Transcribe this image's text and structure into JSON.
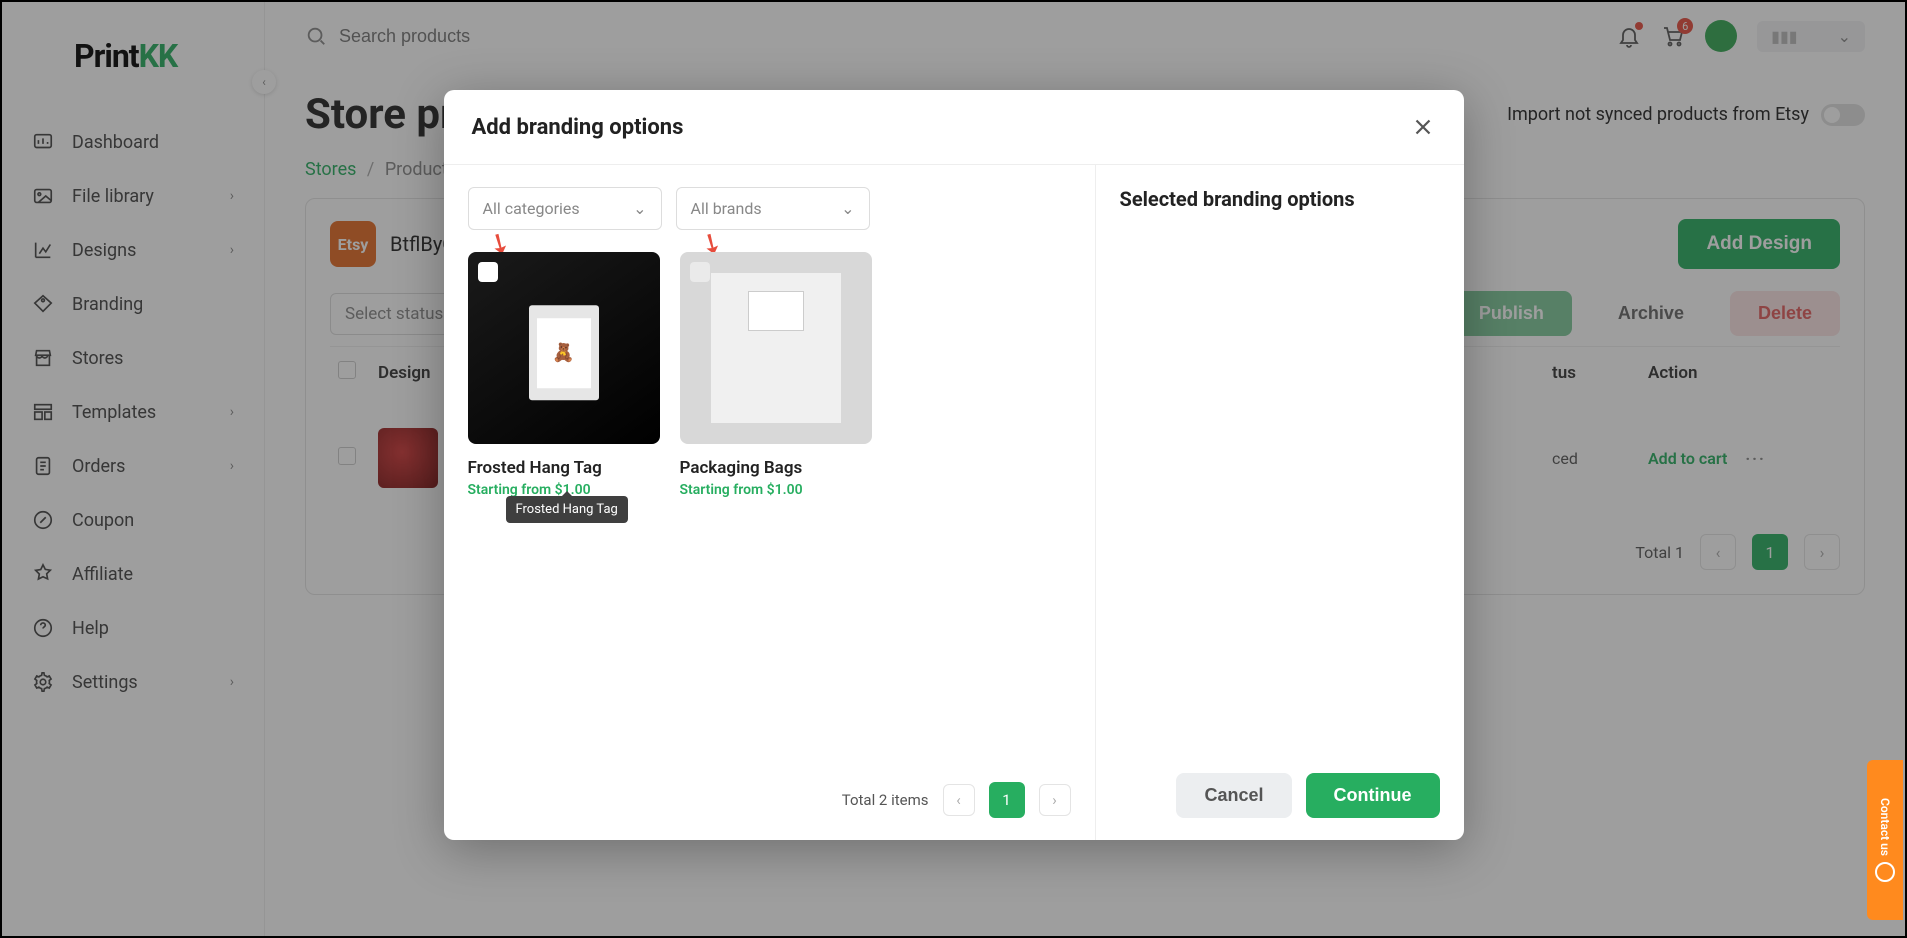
{
  "brand": {
    "p1": "Print",
    "p2": "KK"
  },
  "nav": {
    "dashboard": "Dashboard",
    "file_library": "File library",
    "designs": "Designs",
    "branding": "Branding",
    "stores": "Stores",
    "templates": "Templates",
    "orders": "Orders",
    "coupon": "Coupon",
    "affiliate": "Affiliate",
    "help": "Help",
    "settings": "Settings"
  },
  "search": {
    "placeholder": "Search products"
  },
  "header": {
    "cart_count": "6"
  },
  "page": {
    "title": "Store products",
    "import_label": "Import not synced products from Etsy"
  },
  "breadcrumb": {
    "stores": "Stores",
    "products": "Products"
  },
  "panel": {
    "shop_badge": "Etsy",
    "shop_name": "BtflByCe",
    "add_design": "Add Design",
    "select_status": "Select status",
    "publish": "Publish",
    "archive": "Archive",
    "delete": "Delete"
  },
  "table": {
    "col_design": "Design",
    "col_status": "tus",
    "col_action": "Action",
    "row1_status": "ced",
    "row1_action": "Add to cart"
  },
  "pager": {
    "total_label": "Total 1",
    "page": "1"
  },
  "modal": {
    "title": "Add branding options",
    "cat_label": "All categories",
    "brand_label": "All brands",
    "card1": {
      "title": "Frosted Hang Tag",
      "price": "Starting from $1.00"
    },
    "card2": {
      "title": "Packaging Bags",
      "price": "Starting from $1.00"
    },
    "tooltip": "Frosted Hang Tag",
    "total_items": "Total 2 items",
    "page": "1",
    "selected_title": "Selected branding options",
    "cancel": "Cancel",
    "continue": "Continue"
  },
  "contact": {
    "label": "Contact us"
  }
}
